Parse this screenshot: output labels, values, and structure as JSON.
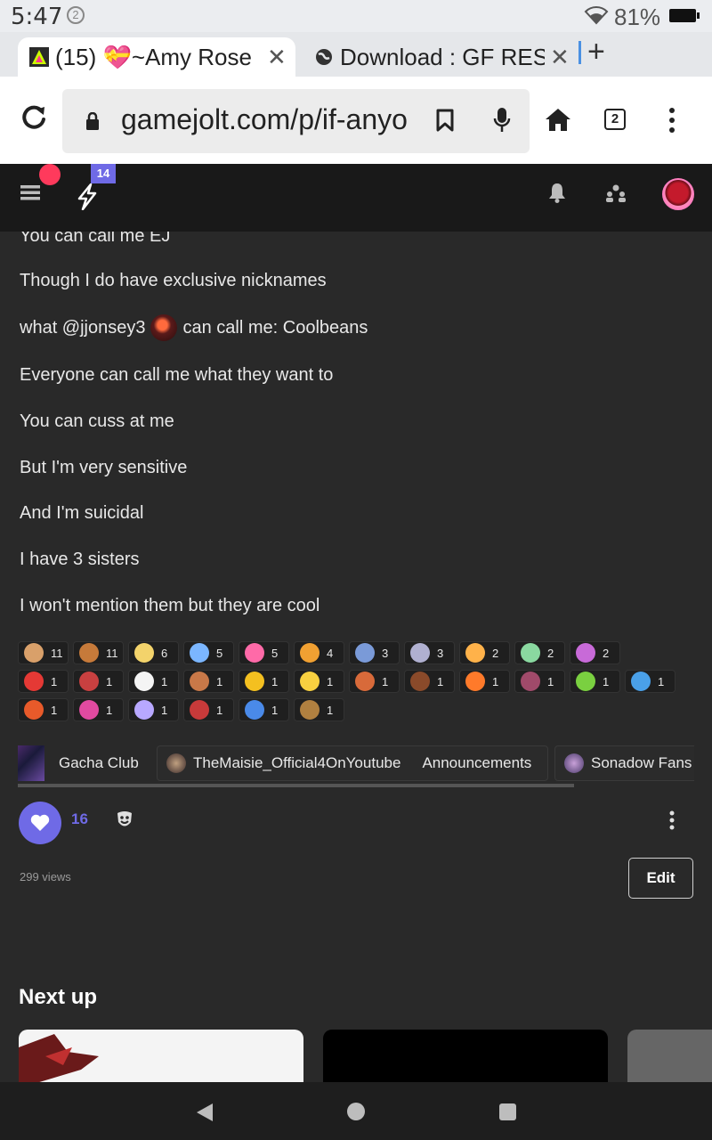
{
  "status": {
    "time": "5:47",
    "notification_count": "2",
    "battery": "81%"
  },
  "tabs": [
    {
      "title": "(15) 💝~Amy Rose",
      "close": "✕"
    },
    {
      "title": "Download : GF RES",
      "close": "✕"
    }
  ],
  "new_tab": "+",
  "toolbar": {
    "url": "gamejolt.com/p/if-anyo",
    "tab_count": "2"
  },
  "header": {
    "badge": "14"
  },
  "post": {
    "lines": [
      "You can call me EJ",
      "Though I do have exclusive nicknames",
      "what @jjonsey3",
      "Everyone can call me what they want to",
      "You can cuss at me",
      "But I'm very sensitive",
      "And I'm suicidal",
      "I have 3 sisters",
      "I won't mention them but they are cool"
    ],
    "mention_suffix": "can call me: Coolbeans"
  },
  "reactions": {
    "row1": [
      "11",
      "11",
      "6",
      "5",
      "5",
      "4",
      "3",
      "3",
      "2",
      "2",
      "2"
    ],
    "row2": [
      "1",
      "1",
      "1",
      "1",
      "1",
      "1",
      "1",
      "1",
      "1",
      "1",
      "1",
      "1"
    ],
    "row3": [
      "1",
      "1",
      "1",
      "1",
      "1",
      "1"
    ]
  },
  "reaction_colors": {
    "row1": [
      "#d9a06a",
      "#c67a3a",
      "#f3d36b",
      "#7bb6ff",
      "#ff6aa8",
      "#f0a032",
      "#7a9ad8",
      "#b0b0d0",
      "#ffb24a",
      "#8ad8a0",
      "#c86ad8"
    ],
    "row2": [
      "#e53935",
      "#c84040",
      "#f4f4f4",
      "#c87848",
      "#f4c020",
      "#f8d040",
      "#d86a3a",
      "#8a4a2a",
      "#ff7a2a",
      "#a04a6a",
      "#7ad040",
      "#4aa0e8"
    ],
    "row3": [
      "#e85a2a",
      "#e04aa0",
      "#b8a8ff",
      "#c83a3a",
      "#4a8ae8",
      "#b08040"
    ]
  },
  "communities": [
    {
      "name": "Gacha Club"
    },
    {
      "name": "TheMaisie_Official4OnYoutube"
    },
    {
      "name": "Announcements"
    },
    {
      "name": "Sonadow Fans"
    }
  ],
  "engagement": {
    "likes": "16",
    "views": "299 views",
    "edit": "Edit"
  },
  "next_up": "Next up"
}
